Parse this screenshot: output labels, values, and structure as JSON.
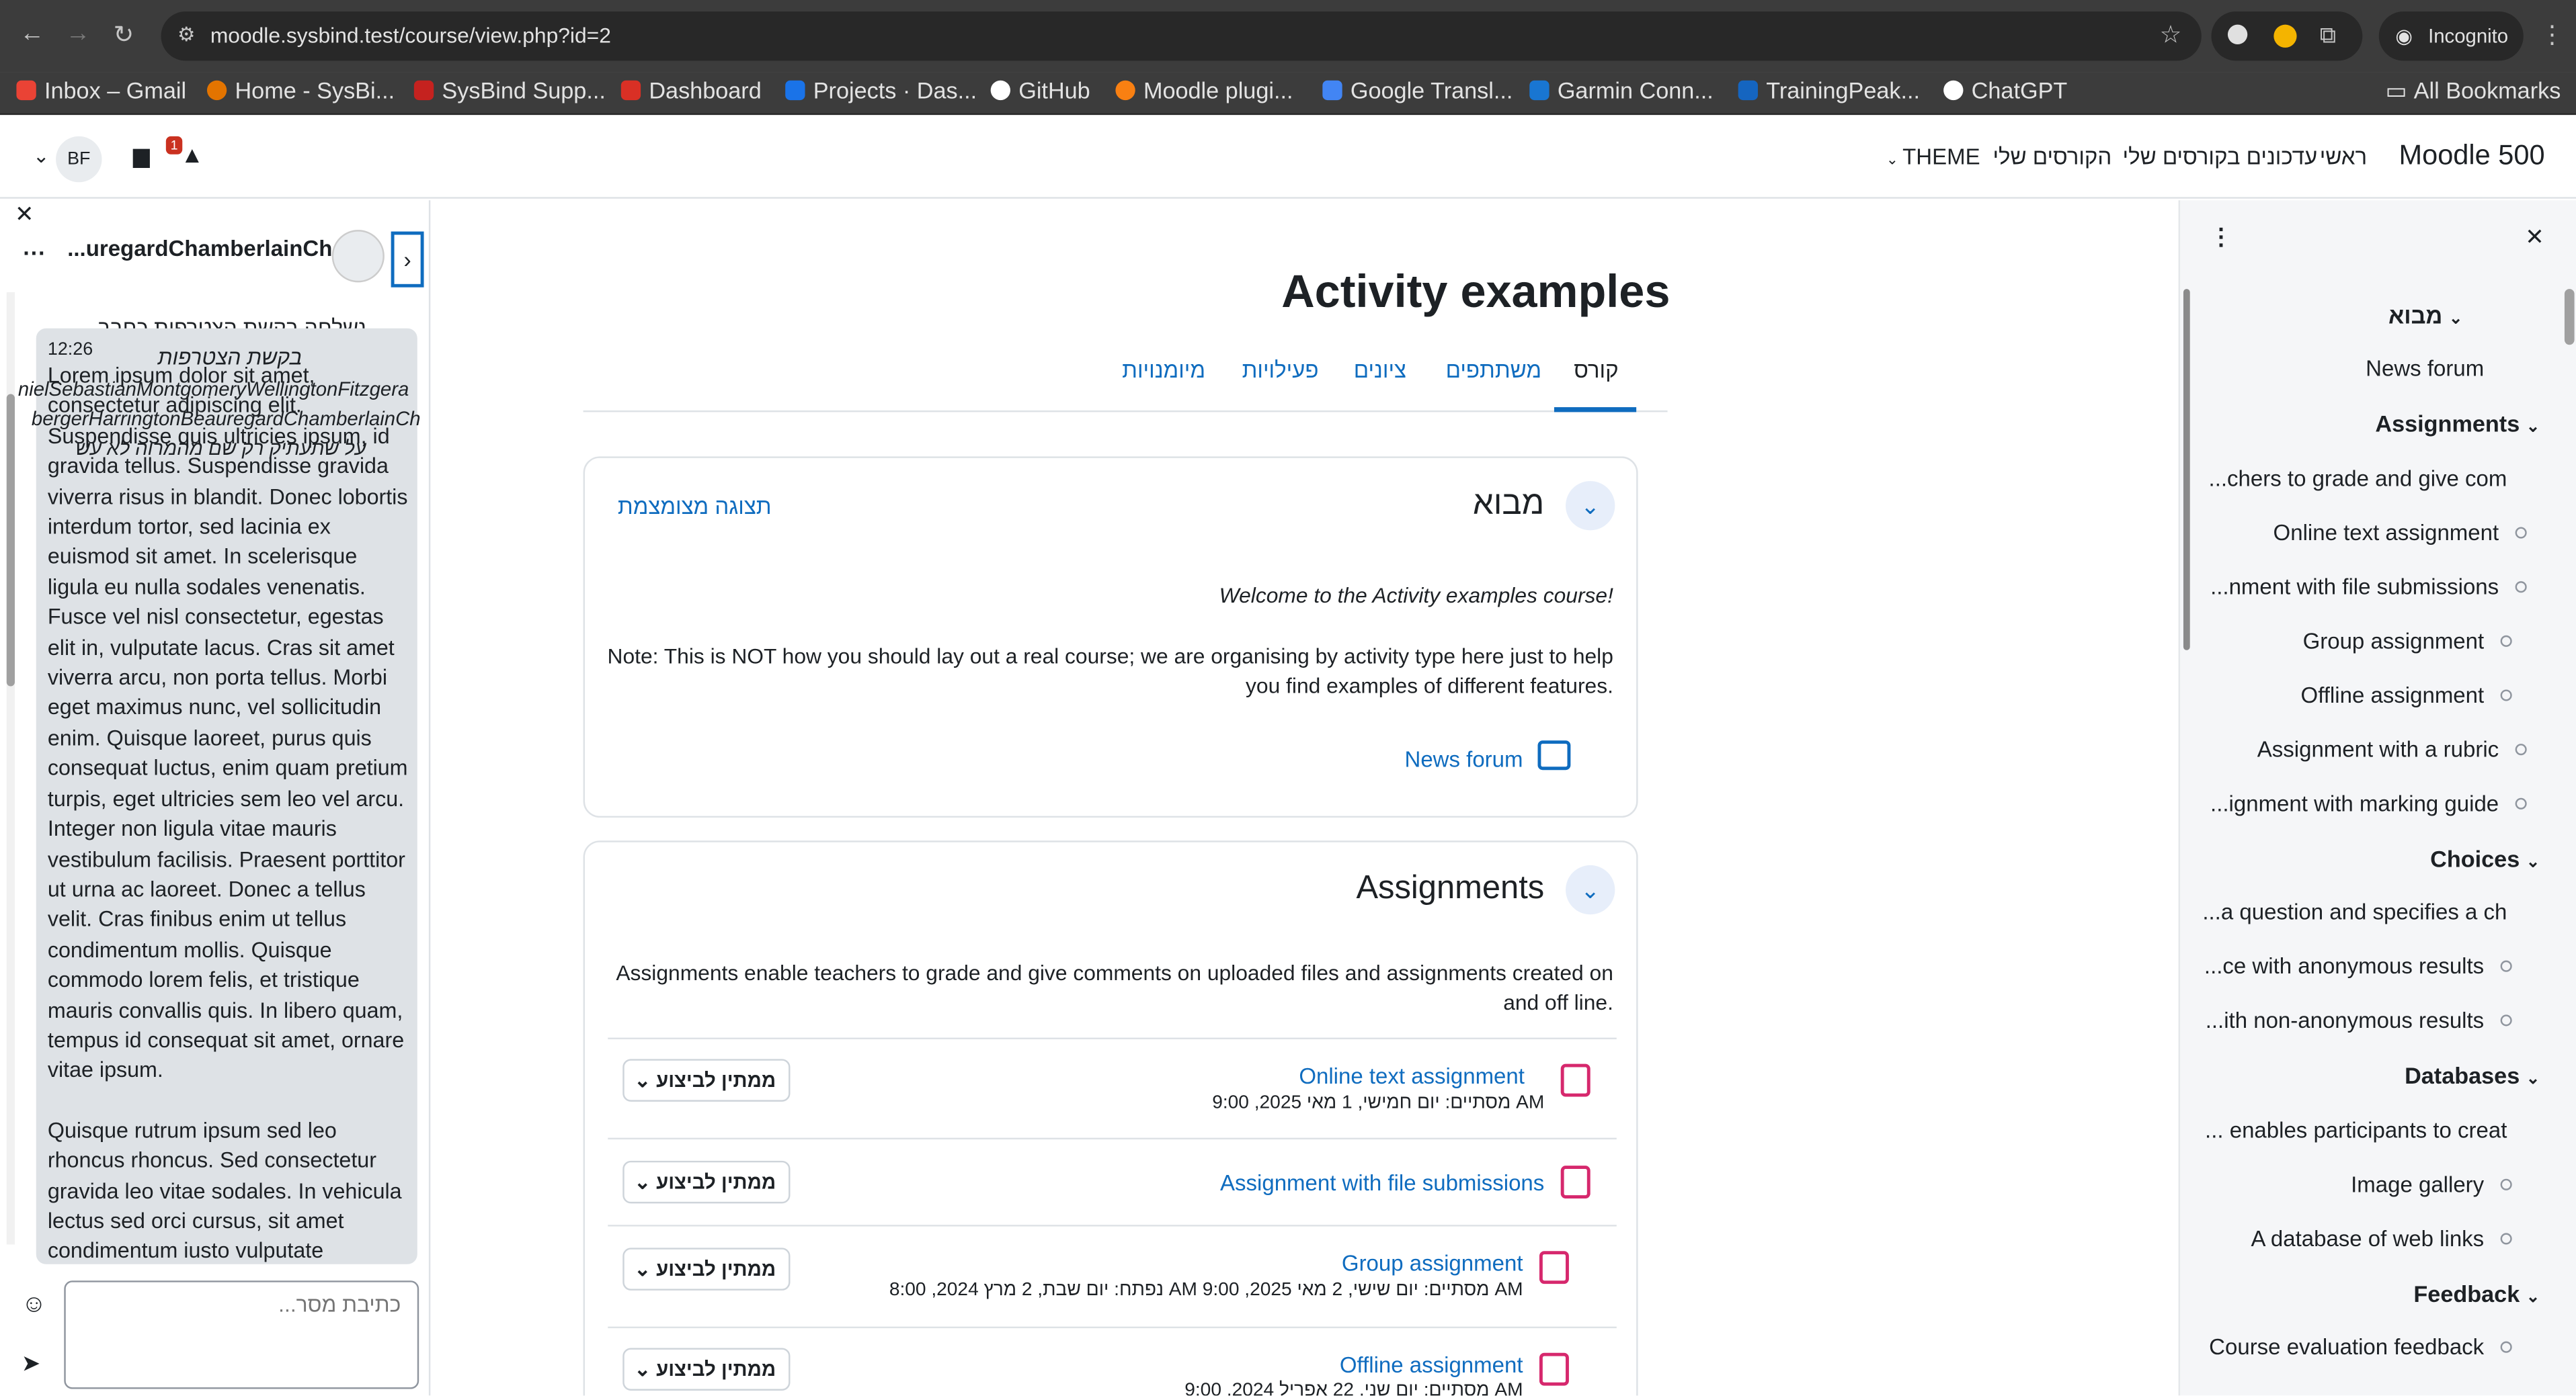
{
  "browser": {
    "url": "moodle.sysbind.test/course/view.php?id=2",
    "incognito": "Incognito",
    "all_bookmarks": "All Bookmarks",
    "bookmarks": [
      {
        "label": "Inbox – Gmail",
        "color": "#ea4335"
      },
      {
        "label": "Home - SysBi...",
        "color": "#e37400"
      },
      {
        "label": "SysBind Supp...",
        "color": "#c5221f"
      },
      {
        "label": "Dashboard",
        "color": "#d93025"
      },
      {
        "label": "Projects · Das...",
        "color": "#1a73e8"
      },
      {
        "label": "GitHub",
        "color": "#ffffff"
      },
      {
        "label": "Moodle plugi...",
        "color": "#f98012"
      },
      {
        "label": "Google Transl...",
        "color": "#4285f4"
      },
      {
        "label": "Garmin Conn...",
        "color": "#1976d2"
      },
      {
        "label": "TrainingPeak...",
        "color": "#1565c0"
      },
      {
        "label": "ChatGPT",
        "color": "#ffffff"
      }
    ]
  },
  "nav": {
    "brand": "Moodle 500",
    "home": "ראשי",
    "updates": "עדכונים בקורסים שלי",
    "mycourses": "הקורסים שלי",
    "theme": "THEME",
    "avatar": "BF",
    "notif_count": "1"
  },
  "chat": {
    "name": "...uregardChamberlainCh",
    "time": "12:26",
    "sys1": "נשלחה בקשת הצטרפות כחבר",
    "sys2": "בקשת הצטרפות",
    "sys3": "nielSebastianMontgomeryWellingtonFitzgera",
    "sys4": "bergerHarringtonBeauregardChamberlainCh",
    "sys5": "על שתעתיק רק שם מהמרוה לא עש",
    "para1": "Lorem ipsum dolor sit amet, consectetur adipiscing elit. Suspendisse quis ultricies ipsum, id gravida tellus. Suspendisse gravida viverra risus in blandit. Donec lobortis interdum tortor, sed lacinia ex euismod sit amet. In scelerisque ligula eu nulla sodales venenatis. Fusce vel nisl consectetur, egestas elit in, vulputate lacus. Cras sit amet viverra arcu, non porta tellus. Morbi eget maximus nunc, vel sollicitudin enim. Quisque laoreet, purus quis consequat luctus, enim quam pretium turpis, eget ultricies sem leo vel arcu. Integer non ligula vitae mauris vestibulum facilisis. Praesent porttitor ut urna ac laoreet. Donec a tellus velit. Cras finibus enim ut tellus condimentum mollis. Quisque commodo lorem felis, et tristique mauris convallis quis. In libero quam, tempus id consequat sit amet, ornare vitae ipsum.",
    "para2": "Quisque rutrum ipsum sed leo rhoncus rhoncus. Sed consectetur gravida leo vitae sodales. In vehicula lectus sed orci cursus, sit amet condimentum iusto vulputate",
    "placeholder": "כתיבת מסר..."
  },
  "course": {
    "title": "Activity examples",
    "tabs": [
      "קורס",
      "משתתפים",
      "ציונים",
      "פעילויות",
      "מיומנויות"
    ],
    "intro": {
      "heading": "מבוא",
      "collapse": "תצוגה מצומצמת",
      "welcome": "Welcome to the Activity examples course!",
      "note1": "Note: This is NOT how you should lay out a real course; we are organising by activity type here just to help",
      "note2": "you find examples of different features.",
      "forum": "News forum"
    },
    "assign": {
      "heading": "Assignments",
      "desc1": "Assignments enable teachers to grade and give comments on uploaded files and assignments created on",
      "desc2": "and off line.",
      "todo": "ממתין לביצוע",
      "items": [
        {
          "name": "Online text assignment",
          "date": "מסתיים: יום חמישי, 1 מאי 2025, 9:00 AM"
        },
        {
          "name": "Assignment with file submissions",
          "date": ""
        },
        {
          "name": "Group assignment",
          "date": "נפתח: יום שבת, 2 מרץ 2024, 8:00 AM   מסתיים: יום שישי, 2 מאי 2025, 9:00 AM"
        },
        {
          "name": "Offline assignment",
          "date": "מסתיים: יום שני, 22 אפריל 2024, 9:00 AM"
        }
      ]
    }
  },
  "index": {
    "items": [
      "מבוא",
      "News forum",
      "Assignments",
      "...chers to grade and give com",
      "Online text assignment",
      "...nment with file submissions",
      "Group assignment",
      "Offline assignment",
      "Assignment with a rubric",
      "...ignment with marking guide",
      "Choices",
      "...a question and specifies a ch",
      "...ce with anonymous results",
      "...ith non-anonymous results",
      "Databases",
      "... enables participants to creat",
      "Image gallery",
      "A database of web links",
      "Feedback",
      "Course evaluation feedback"
    ]
  }
}
